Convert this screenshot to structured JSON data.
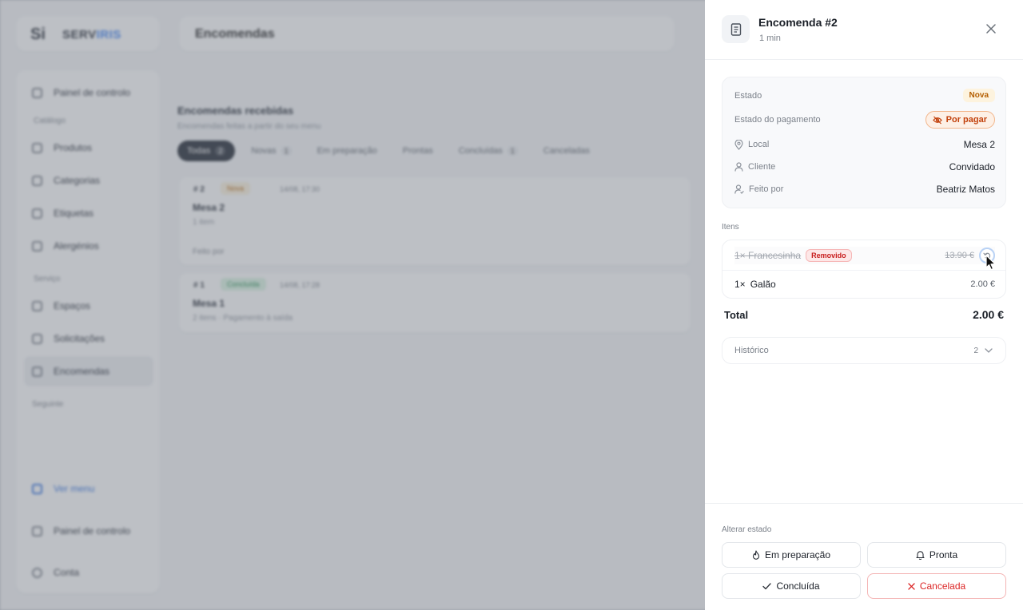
{
  "background": {
    "logo": {
      "mark": "Si",
      "brand_a": "SERV",
      "brand_b": "IRIS"
    },
    "topbar_title": "Encomendas",
    "sidebar": {
      "items": [
        {
          "label": "Painel de controlo"
        },
        {
          "group": "Catálogo"
        },
        {
          "label": "Produtos"
        },
        {
          "label": "Categorias"
        },
        {
          "label": "Etiquetas"
        },
        {
          "label": "Alergénios"
        },
        {
          "group": "Serviço"
        },
        {
          "label": "Espaços"
        },
        {
          "label": "Solicitações"
        },
        {
          "label": "Encomendas"
        },
        {
          "group": "Seguinte"
        },
        {
          "label": "Ver menu"
        },
        {
          "label": "Painel de controlo"
        },
        {
          "label": "Conta"
        }
      ]
    },
    "main": {
      "title": "Encomendas recebidas",
      "subtitle": "Encomendas feitas a partir do seu menu",
      "tabs": [
        {
          "label": "Todas",
          "count": "2"
        },
        {
          "label": "Novas",
          "count": "1"
        },
        {
          "label": "Em preparação",
          "count": ""
        },
        {
          "label": "Prontas",
          "count": ""
        },
        {
          "label": "Concluídas",
          "count": "1"
        },
        {
          "label": "Canceladas",
          "count": ""
        }
      ],
      "orders": [
        {
          "num": "# 2",
          "status": "Nova",
          "time": "14/08, 17:30",
          "title": "Mesa 2",
          "sub": "1 item",
          "foot": "Feito por"
        },
        {
          "num": "# 1",
          "status": "Concluída",
          "time": "14/08, 17:28",
          "title": "Mesa 1",
          "sub": "2 itens · Pagamento à saída",
          "foot": ""
        }
      ]
    }
  },
  "drawer": {
    "title": "Encomenda #2",
    "subtitle": "1 min",
    "info": {
      "estado_label": "Estado",
      "estado_value": "Nova",
      "pagamento_label": "Estado do pagamento",
      "pagamento_value": "Por pagar",
      "local_label": "Local",
      "local_value": "Mesa 2",
      "cliente_label": "Cliente",
      "cliente_value": "Convidado",
      "feito_label": "Feito por",
      "feito_value": "Beatriz Matos"
    },
    "items_label": "Itens",
    "items": [
      {
        "qty": "1×",
        "name": "Francesinha",
        "badge": "Removido",
        "price": "13.90 €"
      },
      {
        "qty": "1×",
        "name": "Galão",
        "badge": "",
        "price": "2.00 €"
      }
    ],
    "total_label": "Total",
    "total_value": "2.00 €",
    "history_label": "Histórico",
    "history_count": "2",
    "footer_label": "Alterar estado",
    "buttons": {
      "preparing": "Em preparação",
      "ready": "Pronta",
      "done": "Concluída",
      "cancelled": "Cancelada"
    }
  },
  "colors": {
    "accent_blue": "#3b82f6",
    "nova": "#b45e00",
    "pay_orange": "#c2410c",
    "removed_red": "#c81e1e",
    "cancel_red": "#dc2626"
  }
}
